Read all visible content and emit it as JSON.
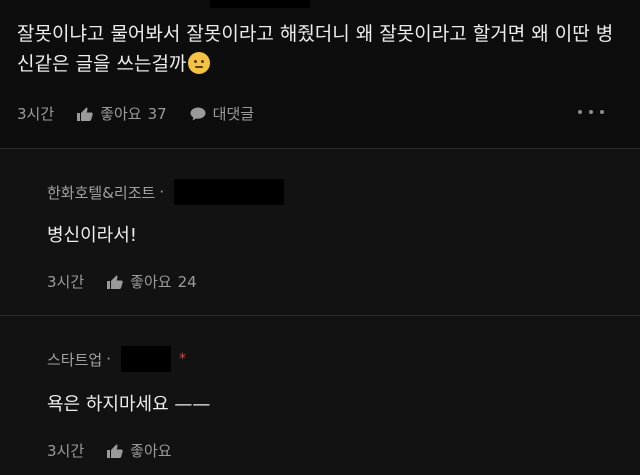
{
  "main_comment": {
    "text": "잘못이냐고 물어봐서 잘못이라고 해줬더니 왜 잘못이라고 할거면 왜 이딴 병신같은 글을 쓰는걸까",
    "emoji": "thinking-face",
    "time": "3시간",
    "like_label": "좋아요",
    "like_count": "37",
    "reply_label": "대댓글"
  },
  "replies": [
    {
      "author": "한화호텔&리조트",
      "text": "병신이라서!",
      "time": "3시간",
      "like_label": "좋아요",
      "like_count": "24"
    },
    {
      "author": "스타트업",
      "required_mark": "*",
      "text": "욕은 하지마세요 ——",
      "time": "3시간",
      "like_label": "좋아요",
      "like_count": ""
    }
  ],
  "colors": {
    "background": "#000000",
    "reply_background": "#121212",
    "text": "#ececec",
    "meta": "#9a9a9a",
    "accent_red": "#d8453c"
  }
}
